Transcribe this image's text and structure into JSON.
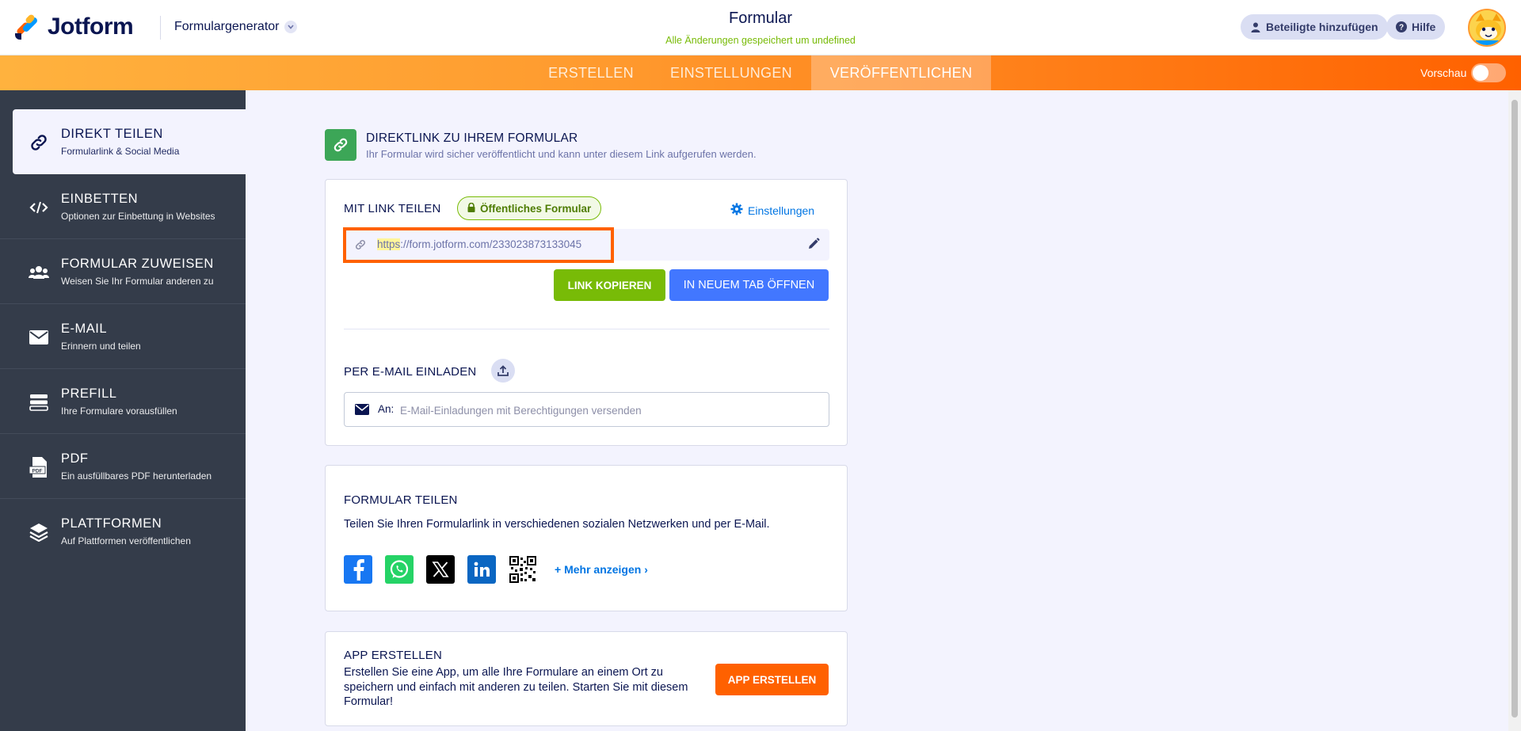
{
  "header": {
    "logo_text": "Jotform",
    "builder_select": "Formulargenerator",
    "form_title": "Formular",
    "save_status": "Alle Änderungen gespeichert um undefined",
    "add_participants": "Beteiligte hinzufügen",
    "help": "Hilfe"
  },
  "nav": {
    "tabs": [
      {
        "label": "ERSTELLEN"
      },
      {
        "label": "EINSTELLUNGEN"
      },
      {
        "label": "VERÖFFENTLICHEN"
      }
    ],
    "active_tab": "VERÖFFENTLICHEN",
    "preview_label": "Vorschau",
    "preview_on": false
  },
  "sidebar": {
    "items": [
      {
        "title": "DIREKT TEILEN",
        "subtitle": "Formularlink & Social Media",
        "icon": "link-icon",
        "active": true
      },
      {
        "title": "EINBETTEN",
        "subtitle": "Optionen zur Einbettung in Websites",
        "icon": "code-icon"
      },
      {
        "title": "FORMULAR ZUWEISEN",
        "subtitle": "Weisen Sie Ihr Formular anderen zu",
        "icon": "users-icon"
      },
      {
        "title": "E-MAIL",
        "subtitle": "Erinnern und teilen",
        "icon": "envelope-icon"
      },
      {
        "title": "PREFILL",
        "subtitle": "Ihre Formulare vorausfüllen",
        "icon": "prefill-icon"
      },
      {
        "title": "PDF",
        "subtitle": "Ein ausfüllbares PDF herunterladen",
        "icon": "pdf-icon"
      },
      {
        "title": "PLATTFORMEN",
        "subtitle": "Auf Plattformen veröffentlichen",
        "icon": "layers-icon"
      }
    ]
  },
  "main": {
    "section_title": "DIREKTLINK ZU IHREM FORMULAR",
    "section_subtitle": "Ihr Formular wird sicher veröffentlicht und kann unter diesem Link aufgerufen werden.",
    "share_link": {
      "label": "MIT LINK TEILEN",
      "badge": "Öffentliches Formular",
      "settings": "Einstellungen",
      "url_scheme": "https",
      "url_rest": "://form.jotform.com/233023873133045",
      "copy_button": "LINK KOPIEREN",
      "open_button": "IN NEUEM TAB ÖFFNEN"
    },
    "email_invite": {
      "label": "PER E-MAIL EINLADEN",
      "to_label": "An:",
      "placeholder": "E-Mail-Einladungen mit Berechtigungen versenden"
    },
    "share_form": {
      "title": "FORMULAR TEILEN",
      "description": "Teilen Sie Ihren Formularlink in verschiedenen sozialen Netzwerken und per E-Mail.",
      "networks": [
        {
          "name": "facebook-icon",
          "color": "#1877f2"
        },
        {
          "name": "whatsapp-icon",
          "color": "#25d366"
        },
        {
          "name": "x-icon",
          "color": "#000000"
        },
        {
          "name": "linkedin-icon",
          "color": "#0a66c2"
        },
        {
          "name": "qr-code-icon",
          "color": "#000000"
        }
      ],
      "more": "Mehr anzeigen"
    },
    "create_app": {
      "title": "APP ERSTELLEN",
      "description": "Erstellen Sie eine App, um alle Ihre Formulare an einem Ort zu speichern und einfach mit anderen zu teilen. Starten Sie mit diesem Formular!",
      "button": "APP ERSTELLEN"
    }
  },
  "colors": {
    "accent_orange": "#ff6100",
    "green": "#78bb07",
    "blue": "#4277ff",
    "sidebar_bg": "#343c4a"
  }
}
